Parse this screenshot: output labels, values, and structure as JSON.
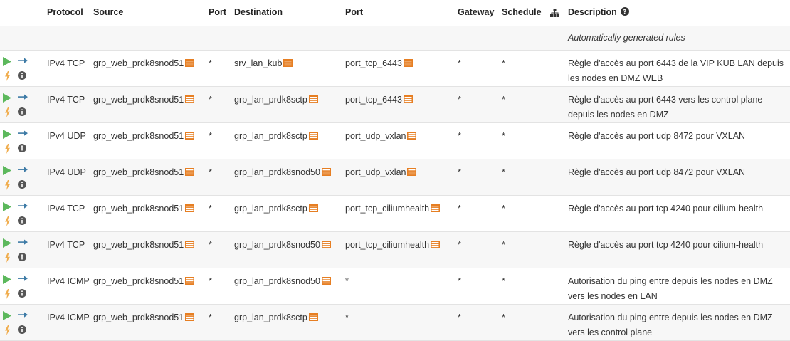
{
  "header": {
    "protocol": "Protocol",
    "source": "Source",
    "source_port": "Port",
    "destination": "Destination",
    "destination_port": "Port",
    "gateway": "Gateway",
    "schedule": "Schedule",
    "description": "Description"
  },
  "auto_row": {
    "text": "Automatically generated rules"
  },
  "colors": {
    "pass": "#5cb85c",
    "direction": "#3e7ba6",
    "log": "#f0ad4e",
    "info": "#555555",
    "alias": "#e67e22"
  },
  "icons": {
    "action": "play-icon",
    "direction": "arrow-right-icon",
    "log": "bolt-icon",
    "info": "info-icon",
    "alias": "list-icon",
    "schedule_tree": "sitemap-icon",
    "help": "question-circle-icon"
  },
  "rules": [
    {
      "protocol": "IPv4 TCP",
      "source": "grp_web_prdk8snod51",
      "source_port": "*",
      "destination": "srv_lan_kub",
      "destination_port": "port_tcp_6443",
      "gateway": "*",
      "schedule": "*",
      "description": "Règle d'accès au port 6443 de la VIP KUB LAN depuis les nodes en DMZ WEB"
    },
    {
      "protocol": "IPv4 TCP",
      "source": "grp_web_prdk8snod51",
      "source_port": "*",
      "destination": "grp_lan_prdk8sctp",
      "destination_port": "port_tcp_6443",
      "gateway": "*",
      "schedule": "*",
      "description": "Règle d'accès au port 6443 vers les control plane depuis les nodes en DMZ"
    },
    {
      "protocol": "IPv4 UDP",
      "source": "grp_web_prdk8snod51",
      "source_port": "*",
      "destination": "grp_lan_prdk8sctp",
      "destination_port": "port_udp_vxlan",
      "gateway": "*",
      "schedule": "*",
      "description": "Règle d'accès au port udp 8472 pour VXLAN"
    },
    {
      "protocol": "IPv4 UDP",
      "source": "grp_web_prdk8snod51",
      "source_port": "*",
      "destination": "grp_lan_prdk8snod50",
      "destination_port": "port_udp_vxlan",
      "gateway": "*",
      "schedule": "*",
      "description": "Règle d'accès au port udp 8472 pour VXLAN"
    },
    {
      "protocol": "IPv4 TCP",
      "source": "grp_web_prdk8snod51",
      "source_port": "*",
      "destination": "grp_lan_prdk8sctp",
      "destination_port": "port_tcp_ciliumhealth",
      "gateway": "*",
      "schedule": "*",
      "description": "Règle d'accès au port tcp 4240 pour cilium-health"
    },
    {
      "protocol": "IPv4 TCP",
      "source": "grp_web_prdk8snod51",
      "source_port": "*",
      "destination": "grp_lan_prdk8snod50",
      "destination_port": "port_tcp_ciliumhealth",
      "gateway": "*",
      "schedule": "*",
      "description": "Règle d'accès au port tcp 4240 pour cilium-health"
    },
    {
      "protocol": "IPv4 ICMP",
      "source": "grp_web_prdk8snod51",
      "source_port": "*",
      "destination": "grp_lan_prdk8snod50",
      "destination_port": "*",
      "gateway": "*",
      "schedule": "*",
      "description": "Autorisation du ping entre depuis les nodes en DMZ vers les nodes en LAN"
    },
    {
      "protocol": "IPv4 ICMP",
      "source": "grp_web_prdk8snod51",
      "source_port": "*",
      "destination": "grp_lan_prdk8sctp",
      "destination_port": "*",
      "gateway": "*",
      "schedule": "*",
      "description": "Autorisation du ping entre depuis les nodes en DMZ vers les control plane"
    }
  ]
}
